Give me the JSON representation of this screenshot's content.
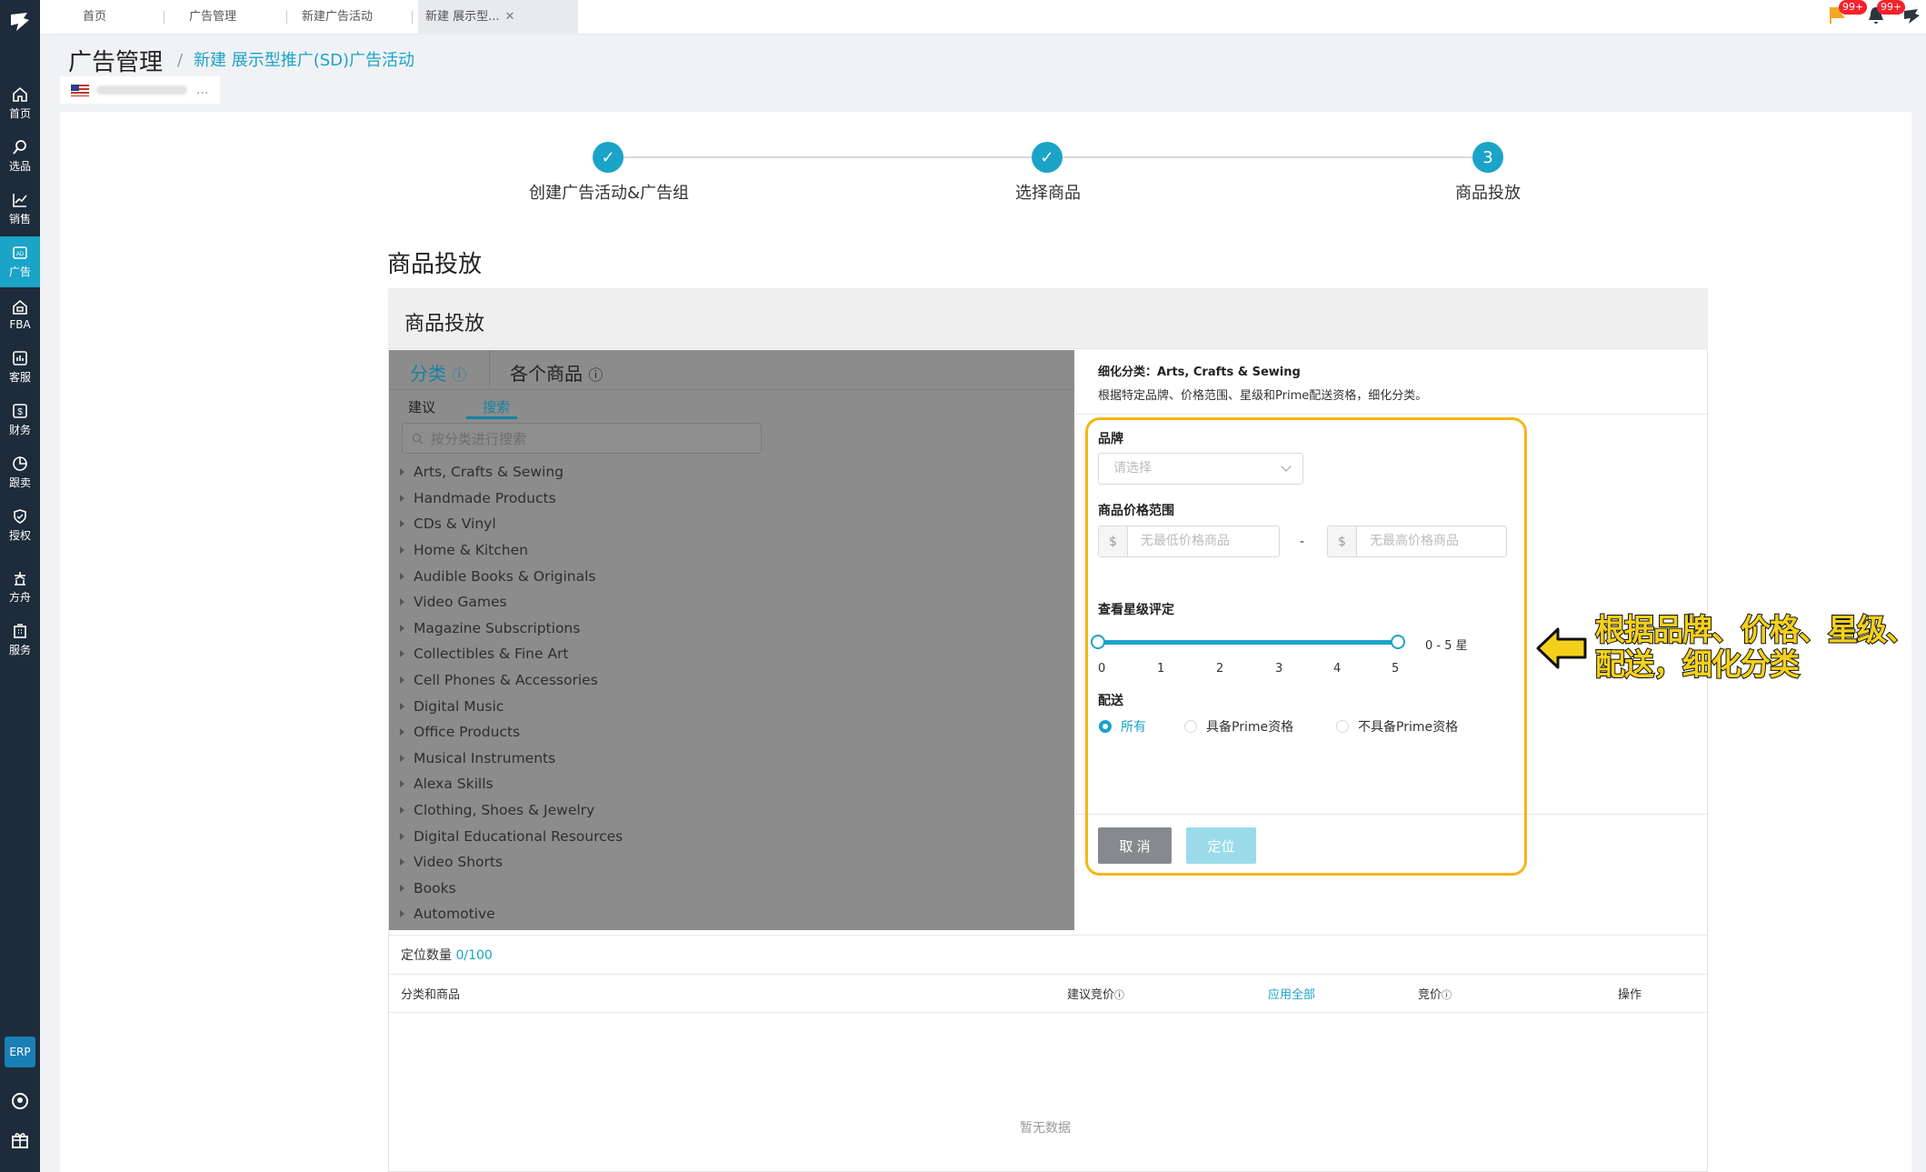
{
  "sidebar": {
    "items": [
      {
        "label": "首页",
        "icon": "home-icon"
      },
      {
        "label": "选品",
        "icon": "search-icon"
      },
      {
        "label": "销售",
        "icon": "chart-icon"
      },
      {
        "label": "广告",
        "icon": "ad-icon",
        "active": true
      },
      {
        "label": "FBA",
        "icon": "fba-icon"
      },
      {
        "label": "客服",
        "icon": "service-icon"
      },
      {
        "label": "财务",
        "icon": "dollar-icon"
      },
      {
        "label": "跟卖",
        "icon": "pie-icon"
      },
      {
        "label": "授权",
        "icon": "shield-icon"
      },
      {
        "label": "方舟",
        "icon": "ark-icon"
      },
      {
        "label": "服务",
        "icon": "building-icon"
      }
    ],
    "erp_label": "ERP"
  },
  "topbar": {
    "tabs": [
      "首页",
      "广告管理",
      "新建广告活动",
      "新建 展示型..."
    ],
    "badge1": "99+",
    "badge2": "99+"
  },
  "header": {
    "title": "广告管理",
    "separator": "/",
    "breadcrumb": "新建 展示型推广(SD)广告活动",
    "store_more": "..."
  },
  "steps": [
    {
      "label": "创建广告活动&广告组",
      "state": "done"
    },
    {
      "label": "选择商品",
      "state": "done"
    },
    {
      "label": "商品投放",
      "state": "current",
      "number": "3"
    }
  ],
  "section": {
    "title": "商品投放",
    "box_title": "商品投放"
  },
  "left": {
    "tab_category": "分类",
    "tab_product": "各个商品",
    "sub_suggest": "建议",
    "sub_search": "搜索",
    "search_placeholder": "按分类进行搜索",
    "categories": [
      "Arts, Crafts & Sewing",
      "Handmade Products",
      "CDs & Vinyl",
      "Home & Kitchen",
      "Audible Books & Originals",
      "Video Games",
      "Magazine Subscriptions",
      "Collectibles & Fine Art",
      "Cell Phones & Accessories",
      "Digital Music",
      "Office Products",
      "Musical Instruments",
      "Alexa Skills",
      "Clothing, Shoes & Jewelry",
      "Digital Educational Resources",
      "Video Shorts",
      "Books",
      "Automotive"
    ]
  },
  "right": {
    "refine_title": "细化分类：Arts, Crafts & Sewing",
    "refine_desc": "根据特定品牌、价格范围、星级和Prime配送资格，细化分类。",
    "brand_label": "品牌",
    "brand_placeholder": "请选择",
    "price_label": "商品价格范围",
    "currency": "$",
    "price_min_placeholder": "无最低价格商品",
    "price_max_placeholder": "无最高价格商品",
    "price_dash": "-",
    "rating_label": "查看星级评定",
    "rating_ticks": [
      "0",
      "1",
      "2",
      "3",
      "4",
      "5"
    ],
    "rating_value": "0 - 5 星",
    "rating_min": 0,
    "rating_max": 5,
    "shipping_label": "配送",
    "shipping_options": [
      "所有",
      "具备Prime资格",
      "不具备Prime资格"
    ],
    "shipping_selected": "所有",
    "cancel_label": "取 消",
    "target_label": "定位"
  },
  "annotation": {
    "text": "根据品牌、价格、星级、配送，细化分类",
    "color": "#f5d01a"
  },
  "table": {
    "count_label": "定位数量",
    "count_value": "0/100",
    "columns": [
      "分类和商品",
      "建议竞价",
      "应用全部",
      "竞价",
      "操作"
    ],
    "empty_text": "暂无数据"
  },
  "colors": {
    "accent": "#1ba3c8",
    "sidebar": "#1d2b3a",
    "highlight": "#f5b614"
  }
}
